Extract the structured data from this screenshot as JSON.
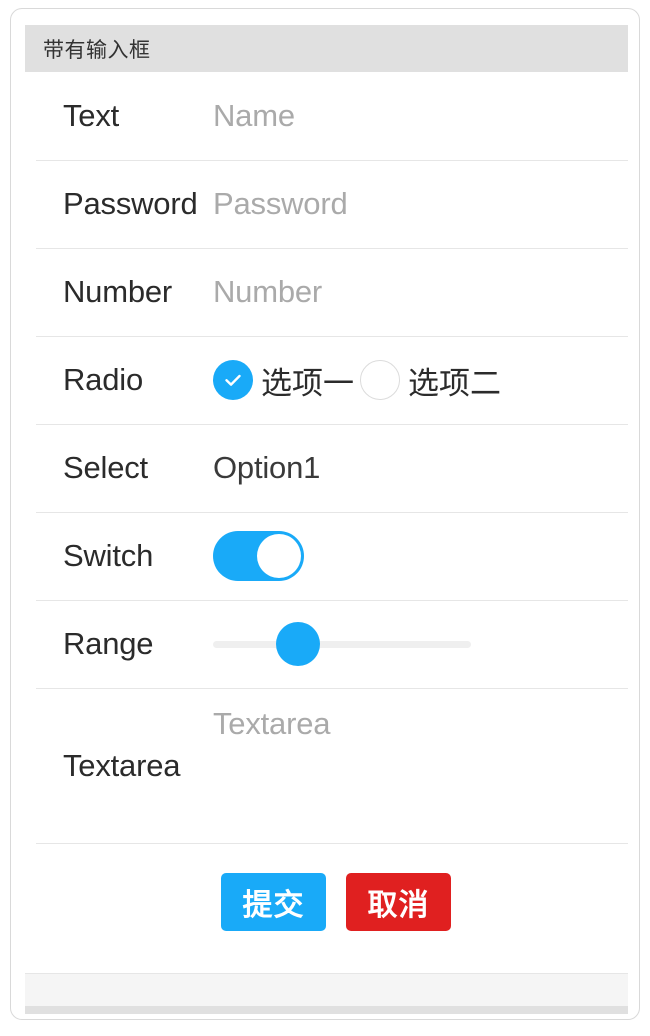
{
  "card": {
    "header_title": "带有输入框"
  },
  "form": {
    "rows": [
      {
        "label": "Text",
        "placeholder": "Name"
      },
      {
        "label": "Password",
        "placeholder": "Password"
      },
      {
        "label": "Number",
        "placeholder": "Number"
      },
      {
        "label": "Radio"
      },
      {
        "label": "Select",
        "value": "Option1"
      },
      {
        "label": "Switch"
      },
      {
        "label": "Range"
      },
      {
        "label": "Textarea",
        "placeholder": "Textarea"
      }
    ],
    "radio": {
      "options": [
        {
          "label": "选项一",
          "checked": "true"
        },
        {
          "label": "选项二",
          "checked": "false"
        }
      ]
    },
    "switch": {
      "state": "on"
    },
    "range": {
      "value": "33",
      "min": "0",
      "max": "100"
    }
  },
  "actions": {
    "submit_label": "提交",
    "cancel_label": "取消"
  },
  "icons": {
    "check": "check-icon"
  },
  "colors": {
    "accent_blue": "#19aaf8",
    "danger_red": "#e02020",
    "header_gray": "#e0e0e0",
    "divider": "#e6e6e6",
    "placeholder_text": "#aaaaaa",
    "label_text": "#2b2b2b",
    "footer_gray": "#f5f5f5"
  }
}
